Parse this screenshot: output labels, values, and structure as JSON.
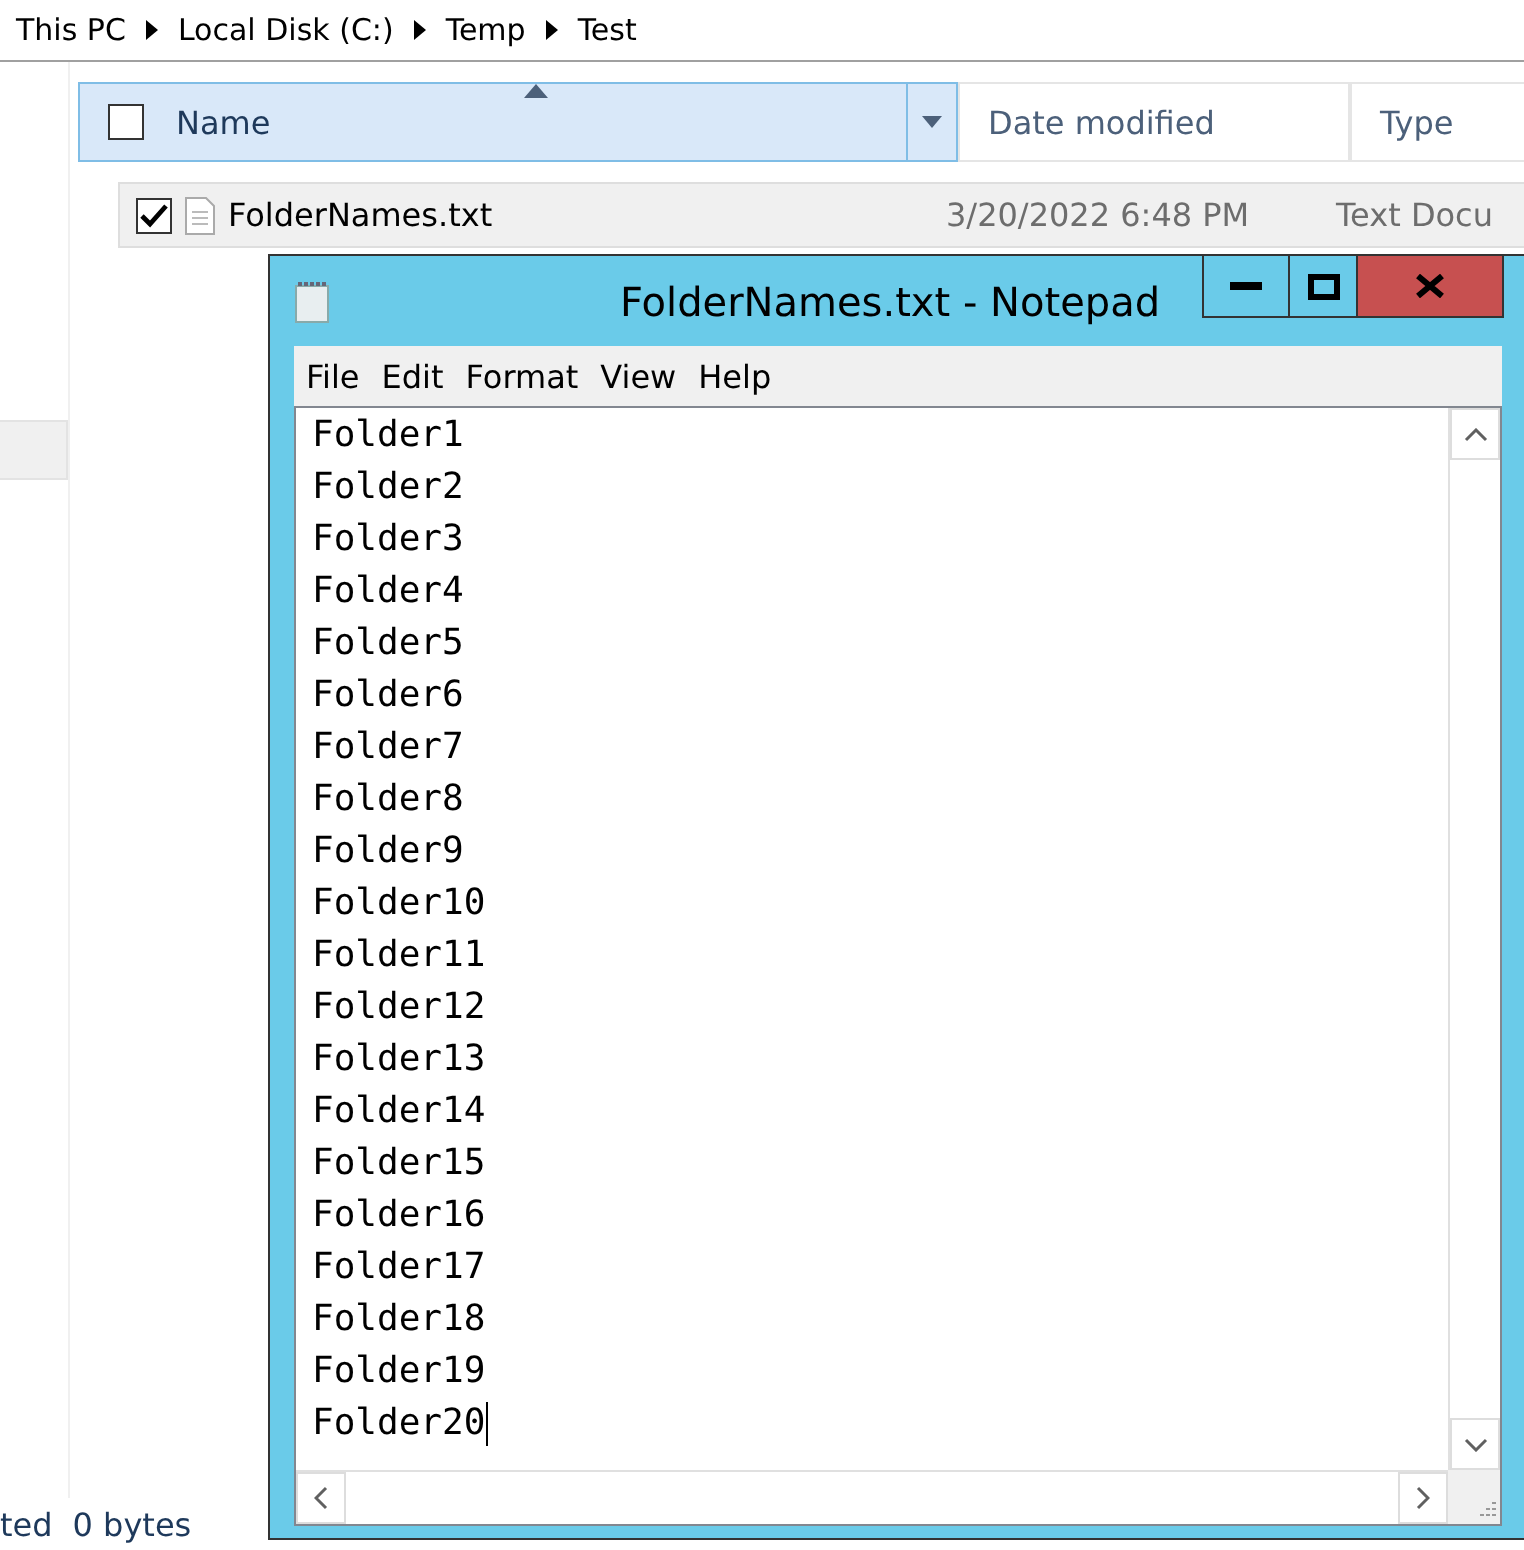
{
  "breadcrumb": [
    "This PC",
    "Local Disk (C:)",
    "Temp",
    "Test"
  ],
  "file_list": {
    "select_all_checked": false,
    "columns": [
      {
        "label": "Name",
        "sorted": true
      },
      {
        "label": "Date modified",
        "sorted": false
      },
      {
        "label": "Type",
        "sorted": false
      }
    ],
    "rows": [
      {
        "name": "FolderNames.txt",
        "date": "3/20/2022 6:48 PM",
        "type": "Text Docu",
        "checked": true
      }
    ]
  },
  "status_bar": [
    "ted",
    "0 bytes"
  ],
  "notepad": {
    "title": "FolderNames.txt - Notepad",
    "menu": [
      "File",
      "Edit",
      "Format",
      "View",
      "Help"
    ],
    "lines": [
      "Folder1",
      "Folder2",
      "Folder3",
      "Folder4",
      "Folder5",
      "Folder6",
      "Folder7",
      "Folder8",
      "Folder9",
      "Folder10",
      "Folder11",
      "Folder12",
      "Folder13",
      "Folder14",
      "Folder15",
      "Folder16",
      "Folder17",
      "Folder18",
      "Folder19",
      "Folder20"
    ]
  }
}
